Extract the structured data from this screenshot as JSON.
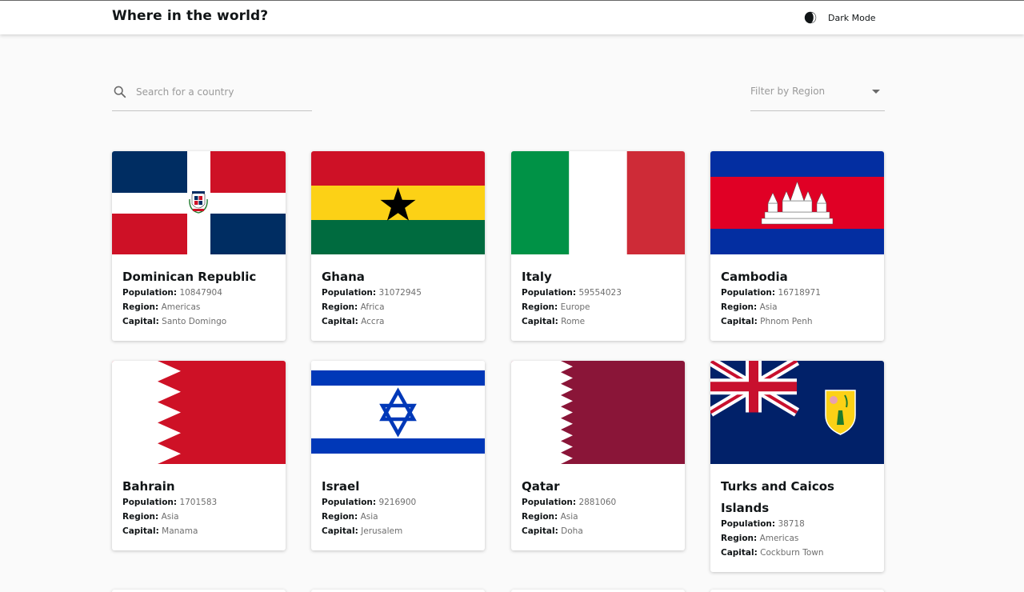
{
  "header": {
    "title": "Where in the world?",
    "theme_toggle_label": "Dark Mode"
  },
  "search": {
    "placeholder": "Search for a country",
    "value": ""
  },
  "filter": {
    "label": "Filter by Region"
  },
  "labels": {
    "population": "Population:",
    "region": "Region:",
    "capital": "Capital:"
  },
  "countries": [
    {
      "name": "Dominican Republic",
      "population": "10847904",
      "region": "Americas",
      "capital": "Santo Domingo",
      "flag_icon": "dominican-republic-flag"
    },
    {
      "name": "Ghana",
      "population": "31072945",
      "region": "Africa",
      "capital": "Accra",
      "flag_icon": "ghana-flag"
    },
    {
      "name": "Italy",
      "population": "59554023",
      "region": "Europe",
      "capital": "Rome",
      "flag_icon": "italy-flag"
    },
    {
      "name": "Cambodia",
      "population": "16718971",
      "region": "Asia",
      "capital": "Phnom Penh",
      "flag_icon": "cambodia-flag"
    },
    {
      "name": "Bahrain",
      "population": "1701583",
      "region": "Asia",
      "capital": "Manama",
      "flag_icon": "bahrain-flag"
    },
    {
      "name": "Israel",
      "population": "9216900",
      "region": "Asia",
      "capital": "Jerusalem",
      "flag_icon": "israel-flag"
    },
    {
      "name": "Qatar",
      "population": "2881060",
      "region": "Asia",
      "capital": "Doha",
      "flag_icon": "qatar-flag"
    },
    {
      "name": "Turks and Caicos Islands",
      "population": "38718",
      "region": "Americas",
      "capital": "Cockburn Town",
      "flag_icon": "turks-and-caicos-flag"
    }
  ],
  "colors": {
    "background": "#fafafa",
    "card": "#ffffff",
    "text": "#111517",
    "muted": "#6e6e6e"
  }
}
